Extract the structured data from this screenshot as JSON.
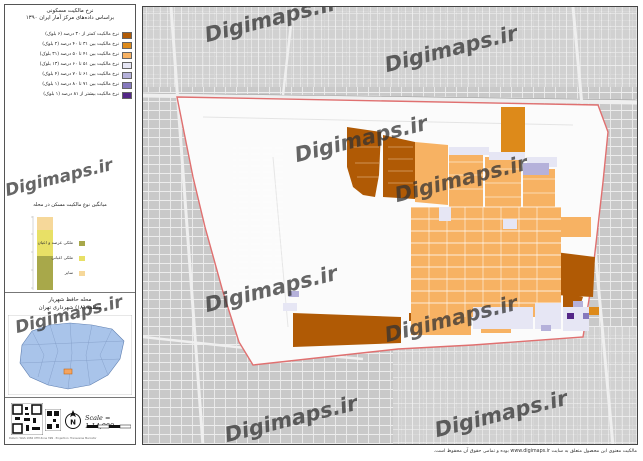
{
  "legend": {
    "title_line1": "نرخ مالکیت مسکونی",
    "title_line2": "براساس داده‌های مرکز آمار ایران ۱۳۹۰",
    "items": [
      {
        "label": "نرخ مالکیت کمتر از ۳۰ درصد (۶ بلوک)",
        "color": "#b05a05"
      },
      {
        "label": "نرخ مالکیت بین ۳۱ تا ۴۰ درصد (۲ بلوک)",
        "color": "#dd8a1a"
      },
      {
        "label": "نرخ مالکیت بین ۴۱ تا ۵۰ درصد (۳۱ بلوک)",
        "color": "#f7b263"
      },
      {
        "label": "نرخ مالکیت بین ۵۱ تا ۶۰ درصد (۱۳ بلوک)",
        "color": "#e6e6f4"
      },
      {
        "label": "نرخ مالکیت بین ۶۱ تا ۷۰ درصد (۴ بلوک)",
        "color": "#b5b1da"
      },
      {
        "label": "نرخ مالکیت بین ۷۱ تا ۸۰ درصد (۱ بلوک)",
        "color": "#8679bd"
      },
      {
        "label": "نرخ مالکیت بیشتر از ۸۱ درصد (۱ بلوک)",
        "color": "#542787"
      }
    ]
  },
  "ownership_chart": {
    "title": "میانگین نوع مالکیت مسکن در محله",
    "items": [
      {
        "label": "ملکی عرصه و اعیان",
        "color": "#a8a84a"
      },
      {
        "label": "ملکی اعیانی",
        "color": "#e8e066"
      },
      {
        "label": "سایر",
        "color": "#f6d89a"
      }
    ]
  },
  "inset": {
    "title_line1": "محله حافظ شهریار",
    "title_line2": "منطقه (۱۸) شهرداری تهران"
  },
  "scale_text": "Scale = 1:14,000",
  "north_icon": "north-arrow-icon",
  "qr_icon": "qr-code-icon",
  "credit": "Datum: WGS 1984 UTM Zone 39N · Projection: Transverse Mercator",
  "watermark": "Digimaps.ir",
  "footer": "مالکیت معنوی این محصول متعلق به سایت www.digimaps.ir بوده و تمامی حقوق آن محفوظ است.",
  "colors": {
    "boundary": "#e07070",
    "neighborhood": "#fafafa",
    "background_map": "#cfcfcf"
  }
}
